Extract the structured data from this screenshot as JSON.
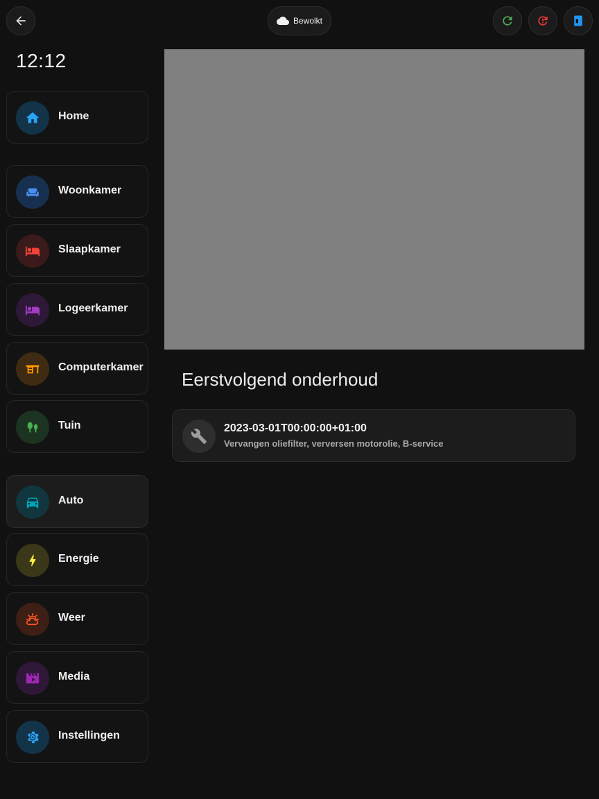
{
  "topbar": {
    "back_icon": "arrow-left-icon",
    "weather": {
      "label": "Bewolkt",
      "icon": "cloud-icon"
    },
    "actions": [
      {
        "icon": "refresh-icon",
        "color": "#4caf50"
      },
      {
        "icon": "alert-restart-icon",
        "color": "#e53935"
      },
      {
        "icon": "panel-icon",
        "color": "#2196f3"
      }
    ]
  },
  "clock": "12:12",
  "nav": [
    {
      "label": "Home",
      "icon": "home-icon",
      "color": "#29a3f5"
    },
    {
      "label": "Woonkamer",
      "icon": "sofa-icon",
      "color": "#4a8ef0"
    },
    {
      "label": "Slaapkamer",
      "icon": "bed-icon",
      "color": "#f44336"
    },
    {
      "label": "Logeerkamer",
      "icon": "bed-guest-icon",
      "color": "#a33bc4"
    },
    {
      "label": "Computerkamer",
      "icon": "desk-icon",
      "color": "#ff9800"
    },
    {
      "label": "Tuin",
      "icon": "trees-icon",
      "color": "#4caf50"
    },
    {
      "label": "Auto",
      "icon": "car-icon",
      "color": "#00a5b8"
    },
    {
      "label": "Energie",
      "icon": "lightning-icon",
      "color": "#ffeb3b"
    },
    {
      "label": "Weer",
      "icon": "sun-cloud-icon",
      "color": "#ff5722"
    },
    {
      "label": "Media",
      "icon": "movie-icon",
      "color": "#9c27b0"
    },
    {
      "label": "Instellingen",
      "icon": "gear-icon",
      "color": "#29a3f5"
    }
  ],
  "maintenance": {
    "title": "Eerstvolgend onderhoud",
    "date": "2023-03-01T00:00:00+01:00",
    "description": "Vervangen oliefilter, verversen motorolie, B-service",
    "icon": "wrench-icon"
  }
}
